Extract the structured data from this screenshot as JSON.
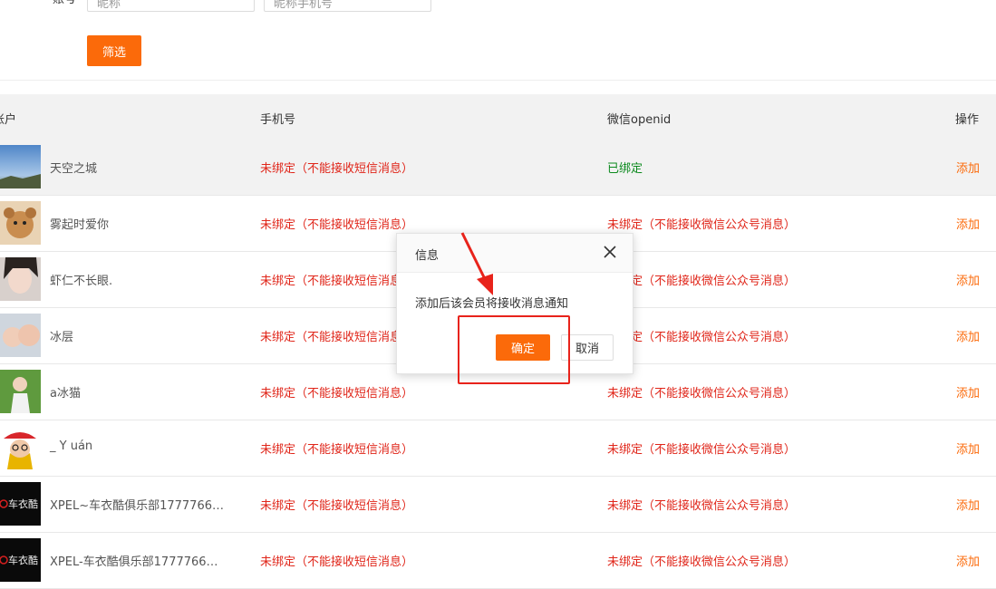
{
  "filters": {
    "label": "账号",
    "nickname_placeholder": "昵称",
    "phone_placeholder": "昵称手机号",
    "filter_button": "筛选"
  },
  "table": {
    "headers": {
      "user": "账户",
      "phone": "手机号",
      "openid": "微信openid",
      "action": "操作"
    },
    "rows": [
      {
        "name": "天空之城",
        "phone": "未绑定（不能接收短信消息）",
        "openid": "已绑定",
        "action": "添加"
      },
      {
        "name": "雾起时爱你",
        "phone": "未绑定（不能接收短信消息）",
        "openid": "未绑定（不能接收微信公众号消息）",
        "action": "添加"
      },
      {
        "name": "虾仁不长眼.",
        "phone": "未绑定（不能接收短信消息）",
        "openid": "未绑定（不能接收微信公众号消息）",
        "action": "添加"
      },
      {
        "name": "冰层",
        "phone": "未绑定（不能接收短信消息）",
        "openid": "未绑定（不能接收微信公众号消息）",
        "action": "添加"
      },
      {
        "name": "a冰猫",
        "phone": "未绑定（不能接收短信消息）",
        "openid": "未绑定（不能接收微信公众号消息）",
        "action": "添加"
      },
      {
        "name": "_ Y uán",
        "phone": "未绑定（不能接收短信消息）",
        "openid": "未绑定（不能接收微信公众号消息）",
        "action": "添加"
      },
      {
        "name": "XPEL~车衣酷俱乐部1777766…",
        "phone": "未绑定（不能接收短信消息）",
        "openid": "未绑定（不能接收微信公众号消息）",
        "action": "添加"
      },
      {
        "name": "XPEL-车衣酷俱乐部1777766…",
        "phone": "未绑定（不能接收短信消息）",
        "openid": "未绑定（不能接收微信公众号消息）",
        "action": "添加"
      }
    ],
    "avatar_logo_text": "车衣酷"
  },
  "dialog": {
    "title": "信息",
    "message": "添加后该会员将接收消息通知",
    "ok_label": "确定",
    "cancel_label": "取消"
  },
  "colors": {
    "accent": "#fb6a0a",
    "unbound": "#e0261a",
    "bound": "#0c8a1e",
    "annotation": "#e8231b"
  }
}
